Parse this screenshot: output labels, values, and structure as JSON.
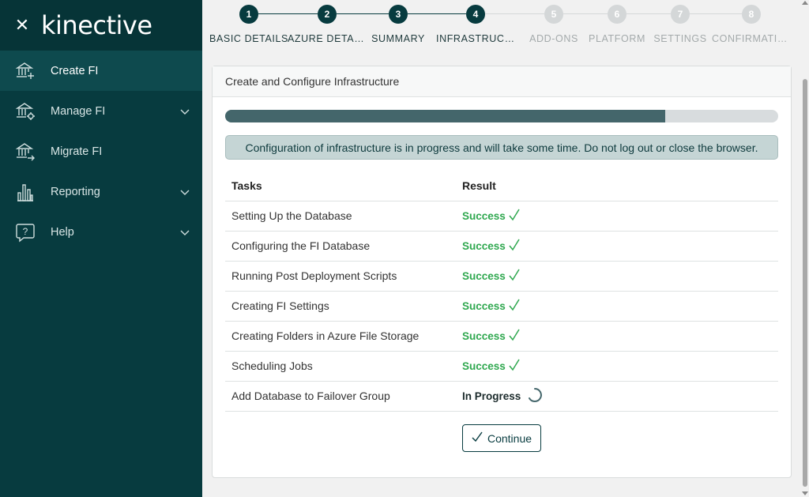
{
  "sidebar": {
    "brand": "kinective",
    "items": [
      {
        "label": "Create FI",
        "icon": "bank-add-icon",
        "active": true,
        "expandable": false
      },
      {
        "label": "Manage FI",
        "icon": "bank-gear-icon",
        "active": false,
        "expandable": true
      },
      {
        "label": "Migrate FI",
        "icon": "bank-arrow-icon",
        "active": false,
        "expandable": false
      },
      {
        "label": "Reporting",
        "icon": "bar-chart-icon",
        "active": false,
        "expandable": true
      },
      {
        "label": "Help",
        "icon": "help-icon",
        "active": false,
        "expandable": true
      }
    ]
  },
  "stepper": {
    "steps": [
      {
        "number": "1",
        "label": "BASIC DETAILS",
        "state": "done"
      },
      {
        "number": "2",
        "label": "AZURE DETAILS",
        "state": "done"
      },
      {
        "number": "3",
        "label": "SUMMARY",
        "state": "done"
      },
      {
        "number": "4",
        "label": "INFRASTRUCTURE",
        "state": "done"
      },
      {
        "number": "5",
        "label": "ADD-ONS",
        "state": "todo"
      },
      {
        "number": "6",
        "label": "PLATFORM",
        "state": "todo"
      },
      {
        "number": "7",
        "label": "SETTINGS",
        "state": "todo"
      },
      {
        "number": "8",
        "label": "CONFIRMATION",
        "state": "todo"
      }
    ]
  },
  "card": {
    "title": "Create and Configure Infrastructure",
    "progress_fraction": 0.795,
    "alert": "Configuration of infrastructure is in progress and will take some time. Do not log out or close the browser.",
    "table": {
      "headers": [
        "Tasks",
        "Result"
      ],
      "rows": [
        {
          "task": "Setting Up the Database",
          "result": "Success",
          "status": "success"
        },
        {
          "task": "Configuring the FI Database",
          "result": "Success",
          "status": "success"
        },
        {
          "task": "Running Post Deployment Scripts",
          "result": "Success",
          "status": "success"
        },
        {
          "task": "Creating FI Settings",
          "result": "Success",
          "status": "success"
        },
        {
          "task": "Creating Folders in Azure File Storage",
          "result": "Success",
          "status": "success"
        },
        {
          "task": "Scheduling Jobs",
          "result": "Success",
          "status": "success"
        },
        {
          "task": "Add Database to Failover Group",
          "result": "In Progress",
          "status": "progress"
        }
      ]
    },
    "continue_label": "Continue"
  },
  "colors": {
    "sidebar": "#073b3f",
    "success": "#2fa84f",
    "progress_fill": "#44666b"
  }
}
